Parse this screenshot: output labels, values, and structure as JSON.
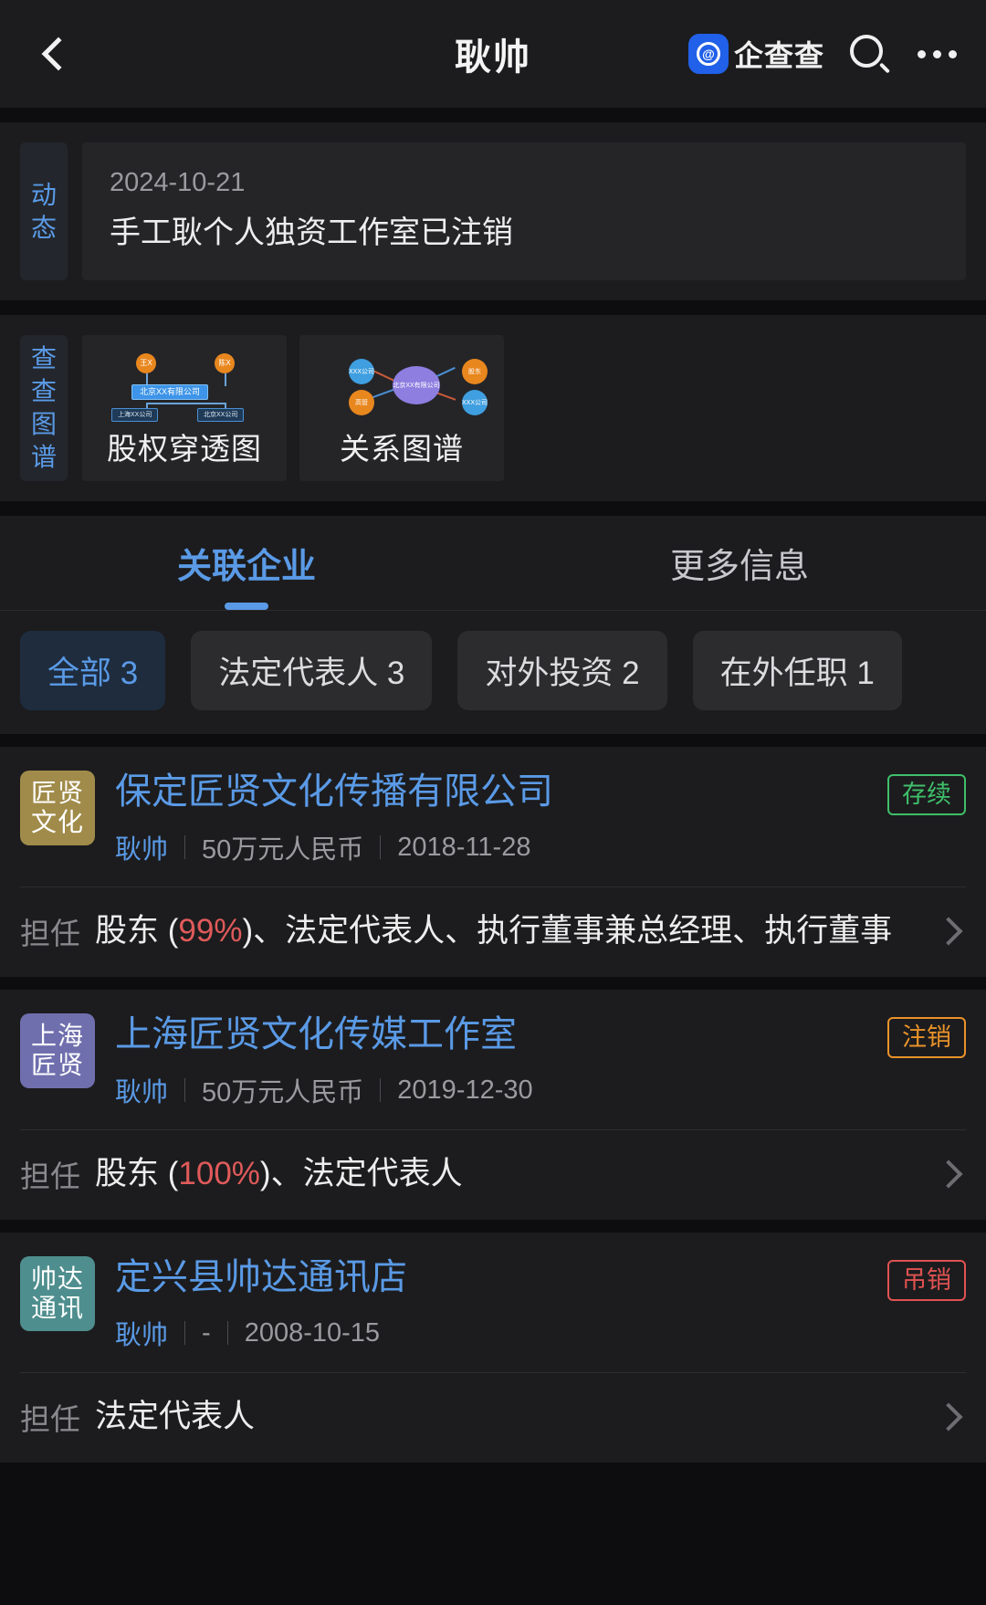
{
  "header": {
    "back_icon": "chevron-left-icon",
    "title": "耿帅",
    "brand_text": "企查查",
    "brand_glyph": "@",
    "search_icon": "search-icon",
    "more_icon": "more-horizontal-icon"
  },
  "dynamics": {
    "side_label": [
      "动",
      "态"
    ],
    "date": "2024-10-21",
    "text": "手工耿个人独资工作室已注销"
  },
  "graphs": {
    "side_label": [
      "查",
      "查",
      "图",
      "谱"
    ],
    "cards": [
      {
        "label": "股权穿透图",
        "nodes": {
          "shareholder_left": "王X",
          "shareholder_right": "陈X",
          "company_main": "北京XX有限公司",
          "sub_left": "上海XX公司",
          "sub_right": "北京XX公司"
        }
      },
      {
        "label": "关系图谱",
        "nodes": {
          "center": "北京XX有限公司",
          "top_left": "XXX公司",
          "top_right": "股东",
          "bottom_left": "高管",
          "bottom_right": "XXX公司"
        }
      }
    ]
  },
  "tabs": [
    {
      "label": "关联企业",
      "active": true
    },
    {
      "label": "更多信息",
      "active": false
    }
  ],
  "filters": [
    {
      "label": "全部 3",
      "active": true
    },
    {
      "label": "法定代表人 3",
      "active": false
    },
    {
      "label": "对外投资 2",
      "active": false
    },
    {
      "label": "在外任职 1",
      "active": false
    }
  ],
  "companies": [
    {
      "logo_lines": [
        "匠贤",
        "文化"
      ],
      "logo_color": "#a08b4a",
      "name": "保定匠贤文化传播有限公司",
      "status": "存续",
      "status_style": "green",
      "person": "耿帅",
      "capital": "50万元人民币",
      "date": "2018-11-28",
      "role_label": "担任",
      "role_prefix": "股东 (",
      "role_percent": "99%",
      "role_suffix": ")、法定代表人、执行董事兼总经理、执行董事"
    },
    {
      "logo_lines": [
        "上海",
        "匠贤"
      ],
      "logo_color": "#6f6fae",
      "name": "上海匠贤文化传媒工作室",
      "status": "注销",
      "status_style": "orange",
      "person": "耿帅",
      "capital": "50万元人民币",
      "date": "2019-12-30",
      "role_label": "担任",
      "role_prefix": "股东 (",
      "role_percent": "100%",
      "role_suffix": ")、法定代表人"
    },
    {
      "logo_lines": [
        "帅达",
        "通讯"
      ],
      "logo_color": "#4f8e8e",
      "name": "定兴县帅达通讯店",
      "status": "吊销",
      "status_style": "red",
      "person": "耿帅",
      "capital": "-",
      "date": "2008-10-15",
      "role_label": "担任",
      "role_prefix": "法定代表人",
      "role_percent": "",
      "role_suffix": ""
    }
  ]
}
